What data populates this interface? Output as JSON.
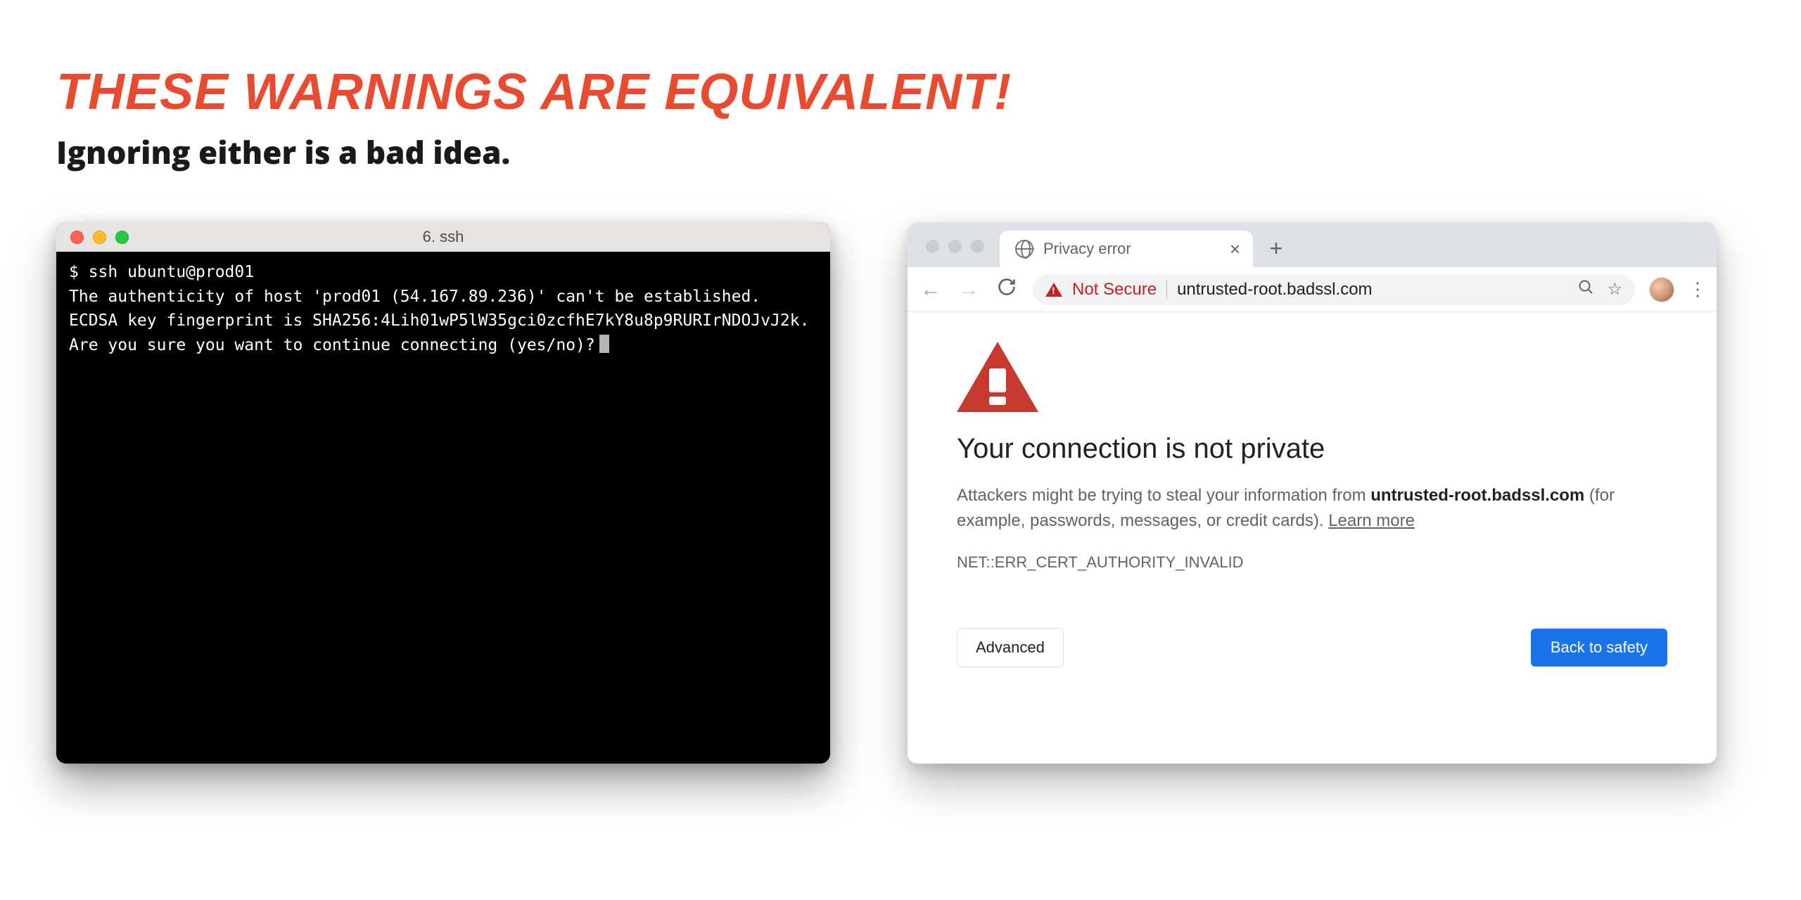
{
  "headline": "THESE WARNINGS ARE EQUIVALENT!",
  "subhead": "Ignoring either is a bad idea.",
  "terminal": {
    "title": "6. ssh",
    "line1": "$ ssh ubuntu@prod01",
    "line2": "The authenticity of host 'prod01 (54.167.89.236)' can't be established.",
    "line3": "ECDSA key fingerprint is SHA256:4Lih01wP5lW35gci0zcfhE7kY8u8p9RURIrNDOJvJ2k.",
    "line4": "Are you sure you want to continue connecting (yes/no)?"
  },
  "browser": {
    "tab_title": "Privacy error",
    "not_secure": "Not Secure",
    "url": "untrusted-root.badssl.com",
    "page_title": "Your connection is not private",
    "desc_pre": "Attackers might be trying to steal your information from ",
    "desc_bold": "untrusted-root.badssl.com",
    "desc_post": " (for example, passwords, messages, or credit cards). ",
    "learn_more": "Learn more",
    "error_code": "NET::ERR_CERT_AUTHORITY_INVALID",
    "advanced": "Advanced",
    "back": "Back to safety"
  }
}
